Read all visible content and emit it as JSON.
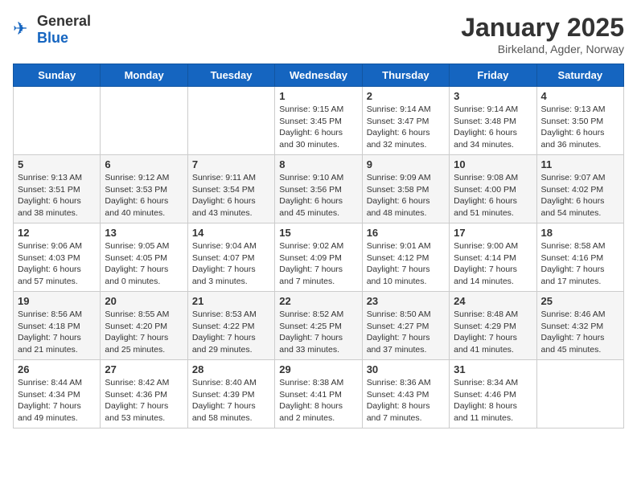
{
  "header": {
    "logo_general": "General",
    "logo_blue": "Blue",
    "title": "January 2025",
    "subtitle": "Birkeland, Agder, Norway"
  },
  "days_of_week": [
    "Sunday",
    "Monday",
    "Tuesday",
    "Wednesday",
    "Thursday",
    "Friday",
    "Saturday"
  ],
  "weeks": [
    [
      {
        "day": "",
        "detail": ""
      },
      {
        "day": "",
        "detail": ""
      },
      {
        "day": "",
        "detail": ""
      },
      {
        "day": "1",
        "detail": "Sunrise: 9:15 AM\nSunset: 3:45 PM\nDaylight: 6 hours\nand 30 minutes."
      },
      {
        "day": "2",
        "detail": "Sunrise: 9:14 AM\nSunset: 3:47 PM\nDaylight: 6 hours\nand 32 minutes."
      },
      {
        "day": "3",
        "detail": "Sunrise: 9:14 AM\nSunset: 3:48 PM\nDaylight: 6 hours\nand 34 minutes."
      },
      {
        "day": "4",
        "detail": "Sunrise: 9:13 AM\nSunset: 3:50 PM\nDaylight: 6 hours\nand 36 minutes."
      }
    ],
    [
      {
        "day": "5",
        "detail": "Sunrise: 9:13 AM\nSunset: 3:51 PM\nDaylight: 6 hours\nand 38 minutes."
      },
      {
        "day": "6",
        "detail": "Sunrise: 9:12 AM\nSunset: 3:53 PM\nDaylight: 6 hours\nand 40 minutes."
      },
      {
        "day": "7",
        "detail": "Sunrise: 9:11 AM\nSunset: 3:54 PM\nDaylight: 6 hours\nand 43 minutes."
      },
      {
        "day": "8",
        "detail": "Sunrise: 9:10 AM\nSunset: 3:56 PM\nDaylight: 6 hours\nand 45 minutes."
      },
      {
        "day": "9",
        "detail": "Sunrise: 9:09 AM\nSunset: 3:58 PM\nDaylight: 6 hours\nand 48 minutes."
      },
      {
        "day": "10",
        "detail": "Sunrise: 9:08 AM\nSunset: 4:00 PM\nDaylight: 6 hours\nand 51 minutes."
      },
      {
        "day": "11",
        "detail": "Sunrise: 9:07 AM\nSunset: 4:02 PM\nDaylight: 6 hours\nand 54 minutes."
      }
    ],
    [
      {
        "day": "12",
        "detail": "Sunrise: 9:06 AM\nSunset: 4:03 PM\nDaylight: 6 hours\nand 57 minutes."
      },
      {
        "day": "13",
        "detail": "Sunrise: 9:05 AM\nSunset: 4:05 PM\nDaylight: 7 hours\nand 0 minutes."
      },
      {
        "day": "14",
        "detail": "Sunrise: 9:04 AM\nSunset: 4:07 PM\nDaylight: 7 hours\nand 3 minutes."
      },
      {
        "day": "15",
        "detail": "Sunrise: 9:02 AM\nSunset: 4:09 PM\nDaylight: 7 hours\nand 7 minutes."
      },
      {
        "day": "16",
        "detail": "Sunrise: 9:01 AM\nSunset: 4:12 PM\nDaylight: 7 hours\nand 10 minutes."
      },
      {
        "day": "17",
        "detail": "Sunrise: 9:00 AM\nSunset: 4:14 PM\nDaylight: 7 hours\nand 14 minutes."
      },
      {
        "day": "18",
        "detail": "Sunrise: 8:58 AM\nSunset: 4:16 PM\nDaylight: 7 hours\nand 17 minutes."
      }
    ],
    [
      {
        "day": "19",
        "detail": "Sunrise: 8:56 AM\nSunset: 4:18 PM\nDaylight: 7 hours\nand 21 minutes."
      },
      {
        "day": "20",
        "detail": "Sunrise: 8:55 AM\nSunset: 4:20 PM\nDaylight: 7 hours\nand 25 minutes."
      },
      {
        "day": "21",
        "detail": "Sunrise: 8:53 AM\nSunset: 4:22 PM\nDaylight: 7 hours\nand 29 minutes."
      },
      {
        "day": "22",
        "detail": "Sunrise: 8:52 AM\nSunset: 4:25 PM\nDaylight: 7 hours\nand 33 minutes."
      },
      {
        "day": "23",
        "detail": "Sunrise: 8:50 AM\nSunset: 4:27 PM\nDaylight: 7 hours\nand 37 minutes."
      },
      {
        "day": "24",
        "detail": "Sunrise: 8:48 AM\nSunset: 4:29 PM\nDaylight: 7 hours\nand 41 minutes."
      },
      {
        "day": "25",
        "detail": "Sunrise: 8:46 AM\nSunset: 4:32 PM\nDaylight: 7 hours\nand 45 minutes."
      }
    ],
    [
      {
        "day": "26",
        "detail": "Sunrise: 8:44 AM\nSunset: 4:34 PM\nDaylight: 7 hours\nand 49 minutes."
      },
      {
        "day": "27",
        "detail": "Sunrise: 8:42 AM\nSunset: 4:36 PM\nDaylight: 7 hours\nand 53 minutes."
      },
      {
        "day": "28",
        "detail": "Sunrise: 8:40 AM\nSunset: 4:39 PM\nDaylight: 7 hours\nand 58 minutes."
      },
      {
        "day": "29",
        "detail": "Sunrise: 8:38 AM\nSunset: 4:41 PM\nDaylight: 8 hours\nand 2 minutes."
      },
      {
        "day": "30",
        "detail": "Sunrise: 8:36 AM\nSunset: 4:43 PM\nDaylight: 8 hours\nand 7 minutes."
      },
      {
        "day": "31",
        "detail": "Sunrise: 8:34 AM\nSunset: 4:46 PM\nDaylight: 8 hours\nand 11 minutes."
      },
      {
        "day": "",
        "detail": ""
      }
    ]
  ]
}
